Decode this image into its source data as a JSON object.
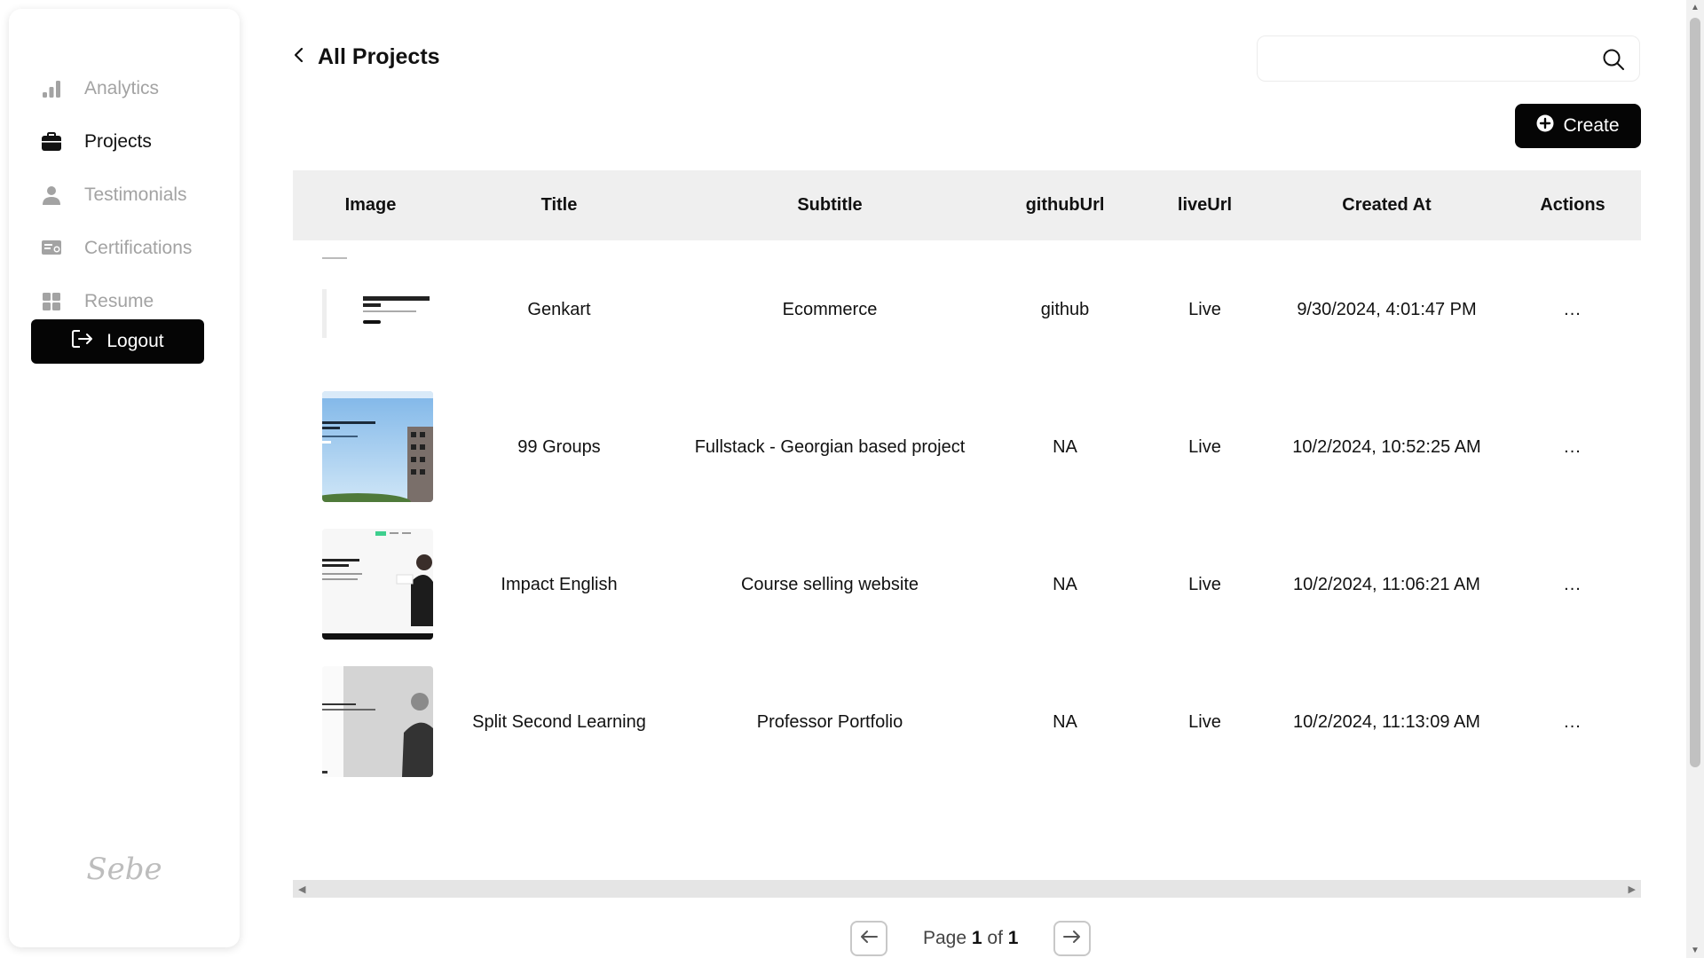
{
  "sidebar": {
    "items": [
      {
        "label": "Analytics",
        "icon": "bar-chart-icon",
        "active": false
      },
      {
        "label": "Projects",
        "icon": "briefcase-icon",
        "active": true
      },
      {
        "label": "Testimonials",
        "icon": "user-icon",
        "active": false
      },
      {
        "label": "Certifications",
        "icon": "certificate-icon",
        "active": false
      },
      {
        "label": "Resume",
        "icon": "grid-icon",
        "active": false
      }
    ],
    "logout_label": "Logout",
    "logo_text": "Sebe"
  },
  "header": {
    "title": "All Projects",
    "search_placeholder": "",
    "create_label": "Create"
  },
  "table": {
    "columns": [
      "Image",
      "Title",
      "Subtitle",
      "githubUrl",
      "liveUrl",
      "Created At",
      "Actions"
    ],
    "rows": [
      {
        "title": "Genkart",
        "subtitle": "Ecommerce",
        "github": "github",
        "live": "Live",
        "created": "9/30/2024, 4:01:47 PM",
        "actions": "...",
        "thumb_text": "Don't be slow! Our prices are low!"
      },
      {
        "title": "99 Groups",
        "subtitle": "Fullstack - Georgian based project",
        "github": "NA",
        "live": "Live",
        "created": "10/2/2024, 10:52:25 AM",
        "actions": "...",
        "thumb_text": "ving Your Lifestyle with Expe"
      },
      {
        "title": "Impact English",
        "subtitle": "Course selling website",
        "github": "NA",
        "live": "Live",
        "created": "10/2/2024, 11:06:21 AM",
        "actions": "...",
        "thumb_text": ""
      },
      {
        "title": "Split Second Learning",
        "subtitle": "Professor Portfolio",
        "github": "NA",
        "live": "Live",
        "created": "10/2/2024, 11:13:09 AM",
        "actions": "...",
        "thumb_text": ""
      }
    ]
  },
  "pagination": {
    "prefix": "Page",
    "current": "1",
    "of": "of",
    "total": "1"
  },
  "colors": {
    "accent": "#050505",
    "header_bg": "#efefef",
    "inactive_text": "#a3a3a3"
  }
}
